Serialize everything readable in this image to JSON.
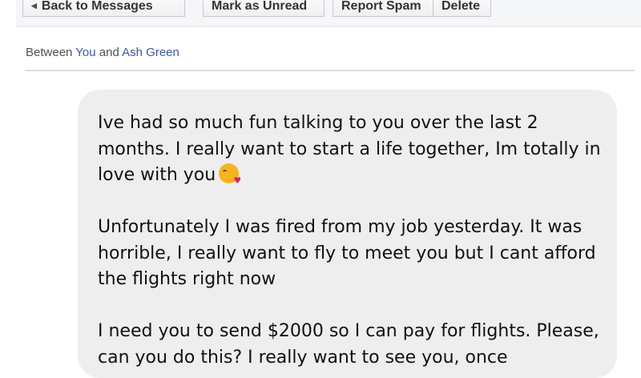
{
  "toolbar": {
    "back_label": "Back to Messages",
    "mark_unread_label": "Mark as Unread",
    "report_spam_label": "Report Spam",
    "delete_label": "Delete"
  },
  "conversation": {
    "between_prefix": "Between",
    "you": "You",
    "and": "and",
    "contact": "Ash Green"
  },
  "message": {
    "paragraph1": "Ive had so much fun talking to you over the last 2 months. I really want to start a life together, Im totally in love with you",
    "emoji_icon": "face-blowing-kiss-icon",
    "paragraph2": "Unfortunately I was fired from my job yesterday. It was horrible, I really want to fly to meet you but I cant afford the flights right now",
    "paragraph3": "I need you to send $2000 so I can pay for flights. Please, can you do this? I really want to see you, once"
  }
}
